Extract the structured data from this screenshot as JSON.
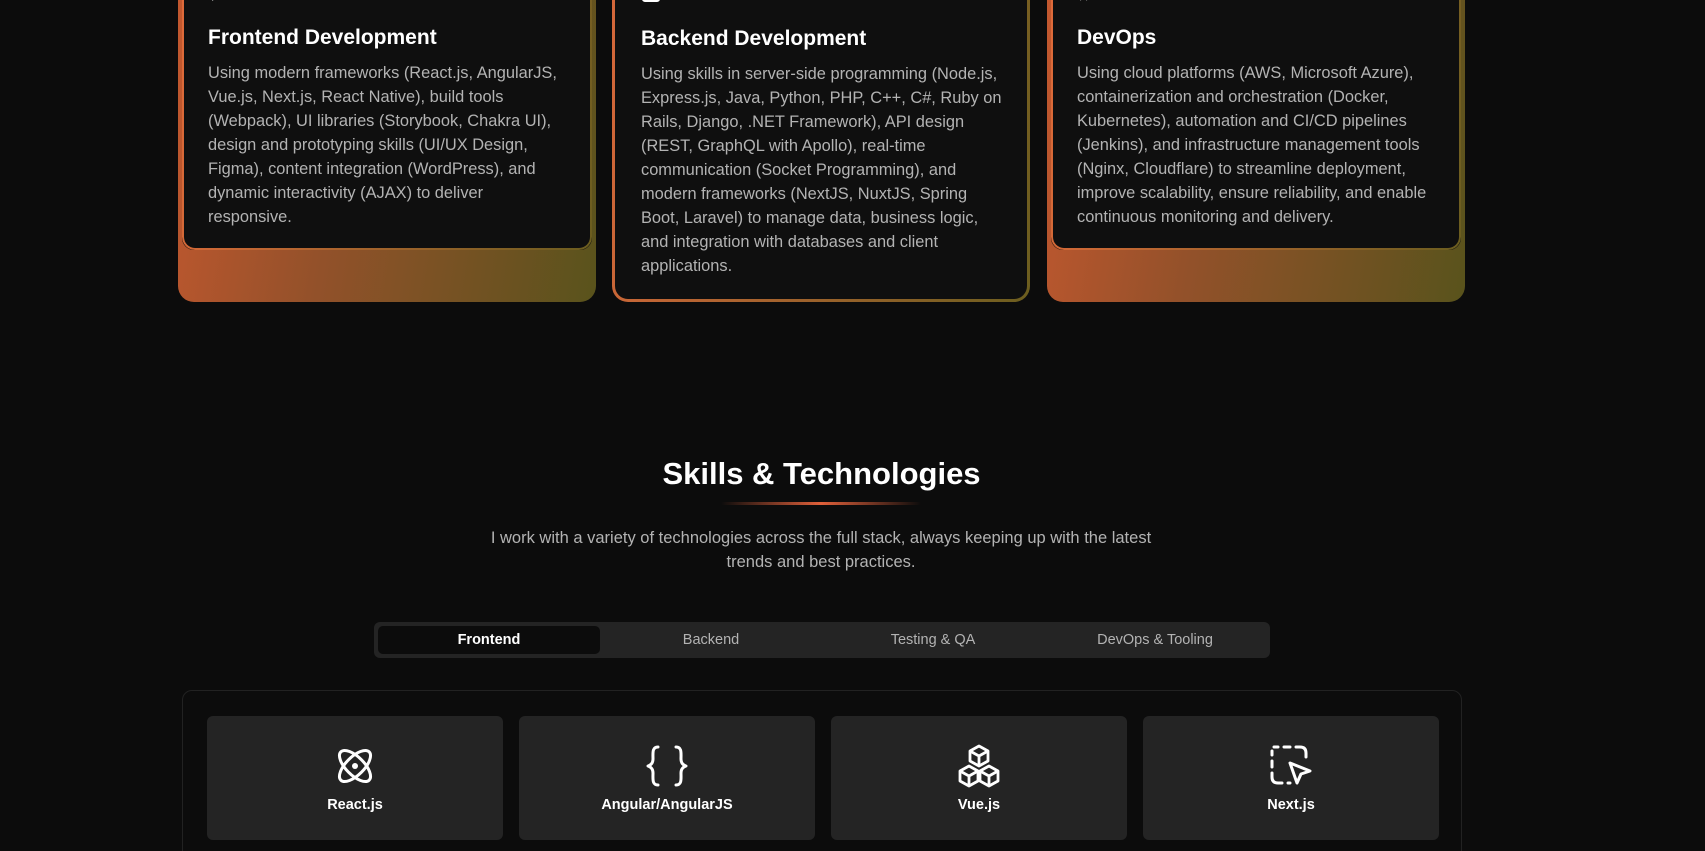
{
  "services": [
    {
      "icon": "code-icon",
      "title": "Frontend Development",
      "text": "Using modern frameworks (React.js, AngularJS, Vue.js, Next.js, React Native), build tools (Webpack), UI libraries (Storybook, Chakra UI), design and prototyping skills (UI/UX Design, Figma), content integration (WordPress), and dynamic interactivity (AJAX) to deliver responsive."
    },
    {
      "icon": "server-icon",
      "title": "Backend Development",
      "text": "Using skills in server-side programming (Node.js, Express.js, Java, Python, PHP, C++, C#, Ruby on Rails, Django, .NET Framework), API design (REST, GraphQL with Apollo), real-time communication (Socket Programming), and modern frameworks (NextJS, NuxtJS, Spring Boot, Laravel) to manage data, business logic, and integration with databases and client applications."
    },
    {
      "icon": "devops-icon",
      "title": "DevOps",
      "text": "Using cloud platforms (AWS, Microsoft Azure), containerization and orchestration (Docker, Kubernetes), automation and CI/CD pipelines (Jenkins), and infrastructure management tools (Nginx, Cloudflare) to streamline deployment, improve scalability, ensure reliability, and enable continuous monitoring and delivery."
    }
  ],
  "skills": {
    "title": "Skills & Technologies",
    "description": "I work with a variety of technologies across the full stack, always keeping up with the latest trends and best practices.",
    "tabs": [
      "Frontend",
      "Backend",
      "Testing & QA",
      "DevOps & Tooling"
    ],
    "active_tab": "Frontend",
    "items": [
      {
        "name": "React.js",
        "icon": "atom-icon"
      },
      {
        "name": "Angular/AngularJS",
        "icon": "braces-icon"
      },
      {
        "name": "Vue.js",
        "icon": "boxes-icon"
      },
      {
        "name": "Next.js",
        "icon": "cursor-select-icon"
      }
    ]
  },
  "colors": {
    "accent_orange": "#e0603a",
    "accent_olive": "#6c5e1f",
    "background": "#0c0c0c",
    "card": "#242424"
  }
}
